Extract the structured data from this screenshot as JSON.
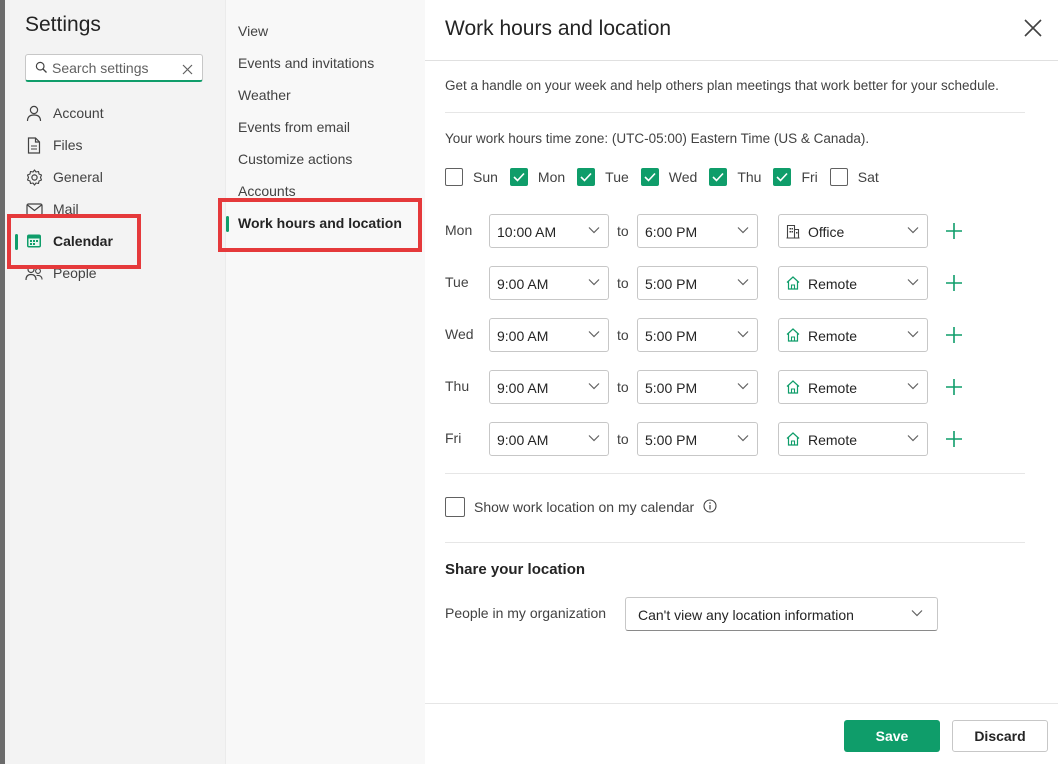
{
  "colors": {
    "accent": "#0f9d6a",
    "highlight": "#e5393b"
  },
  "settings": {
    "title": "Settings",
    "search_placeholder": "Search settings",
    "nav": [
      {
        "label": "Account",
        "icon": "person-icon"
      },
      {
        "label": "Files",
        "icon": "document-icon"
      },
      {
        "label": "General",
        "icon": "gear-icon"
      },
      {
        "label": "Mail",
        "icon": "mail-icon"
      },
      {
        "label": "Calendar",
        "icon": "calendar-icon",
        "active": true
      },
      {
        "label": "People",
        "icon": "people-icon"
      }
    ]
  },
  "calendar_nav": [
    {
      "label": "View"
    },
    {
      "label": "Events and invitations"
    },
    {
      "label": "Weather"
    },
    {
      "label": "Events from email"
    },
    {
      "label": "Customize actions"
    },
    {
      "label": "Accounts"
    },
    {
      "label": "Work hours and location",
      "active": true
    }
  ],
  "panel": {
    "title": "Work hours and location",
    "description": "Get a handle on your week and help others plan meetings that work better for your schedule.",
    "timezone": "Your work hours time zone: (UTC-05:00) Eastern Time (US & Canada).",
    "days": [
      {
        "label": "Sun",
        "checked": false
      },
      {
        "label": "Mon",
        "checked": true
      },
      {
        "label": "Tue",
        "checked": true
      },
      {
        "label": "Wed",
        "checked": true
      },
      {
        "label": "Thu",
        "checked": true
      },
      {
        "label": "Fri",
        "checked": true
      },
      {
        "label": "Sat",
        "checked": false
      }
    ],
    "to_label": "to",
    "schedule": [
      {
        "day": "Mon",
        "start": "10:00 AM",
        "end": "6:00 PM",
        "location": "Office",
        "location_icon": "building-icon"
      },
      {
        "day": "Tue",
        "start": "9:00 AM",
        "end": "5:00 PM",
        "location": "Remote",
        "location_icon": "home-icon"
      },
      {
        "day": "Wed",
        "start": "9:00 AM",
        "end": "5:00 PM",
        "location": "Remote",
        "location_icon": "home-icon"
      },
      {
        "day": "Thu",
        "start": "9:00 AM",
        "end": "5:00 PM",
        "location": "Remote",
        "location_icon": "home-icon"
      },
      {
        "day": "Fri",
        "start": "9:00 AM",
        "end": "5:00 PM",
        "location": "Remote",
        "location_icon": "home-icon"
      }
    ],
    "show_location_label": "Show work location on my calendar",
    "show_location_checked": false,
    "share_heading": "Share your location",
    "share_label": "People in my organization",
    "share_value": "Can't view any location information",
    "save_label": "Save",
    "discard_label": "Discard"
  }
}
